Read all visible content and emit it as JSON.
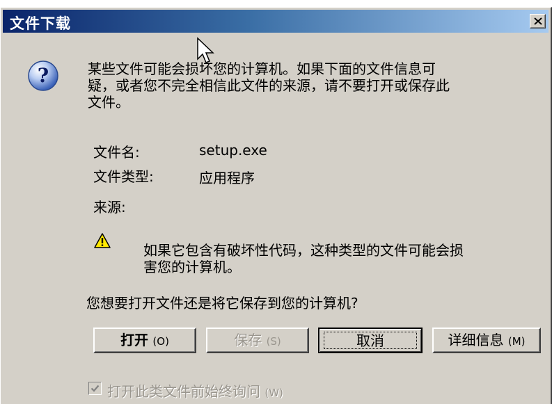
{
  "window": {
    "title": "文件下载",
    "close_icon": "close-icon",
    "title_gradient": [
      "#0a246a",
      "#a6caf0"
    ]
  },
  "message": "某些文件可能会损坏您的计算机。如果下面的文件信息可\n疑，或者您不完全相信此文件的来源，请不要打开或保存此\n文件。",
  "file_info": {
    "name_label": "文件名:",
    "name_value": "setup.exe",
    "type_label": "文件类型:",
    "type_value": "应用程序",
    "source_label": "来源:",
    "source_value": ""
  },
  "warning": {
    "icon": "warning-icon",
    "text": "如果它包含有破坏性代码，这种类型的文件可能会损\n害您的计算机。"
  },
  "question": "您想要打开文件还是将它保存到您的计算机?",
  "buttons": {
    "open": {
      "label": "打开",
      "accel": "(O)"
    },
    "save": {
      "label": "保存",
      "accel": "(S)"
    },
    "cancel": {
      "label": "取消"
    },
    "details": {
      "label": "详细信息",
      "accel": "(M)"
    }
  },
  "checkbox": {
    "label": "打开此类文件前始终询问",
    "accel": "(W)",
    "checked": true
  },
  "colors": {
    "dialog_bg": "#d4d0c8",
    "disabled_text": "#9a968e"
  }
}
